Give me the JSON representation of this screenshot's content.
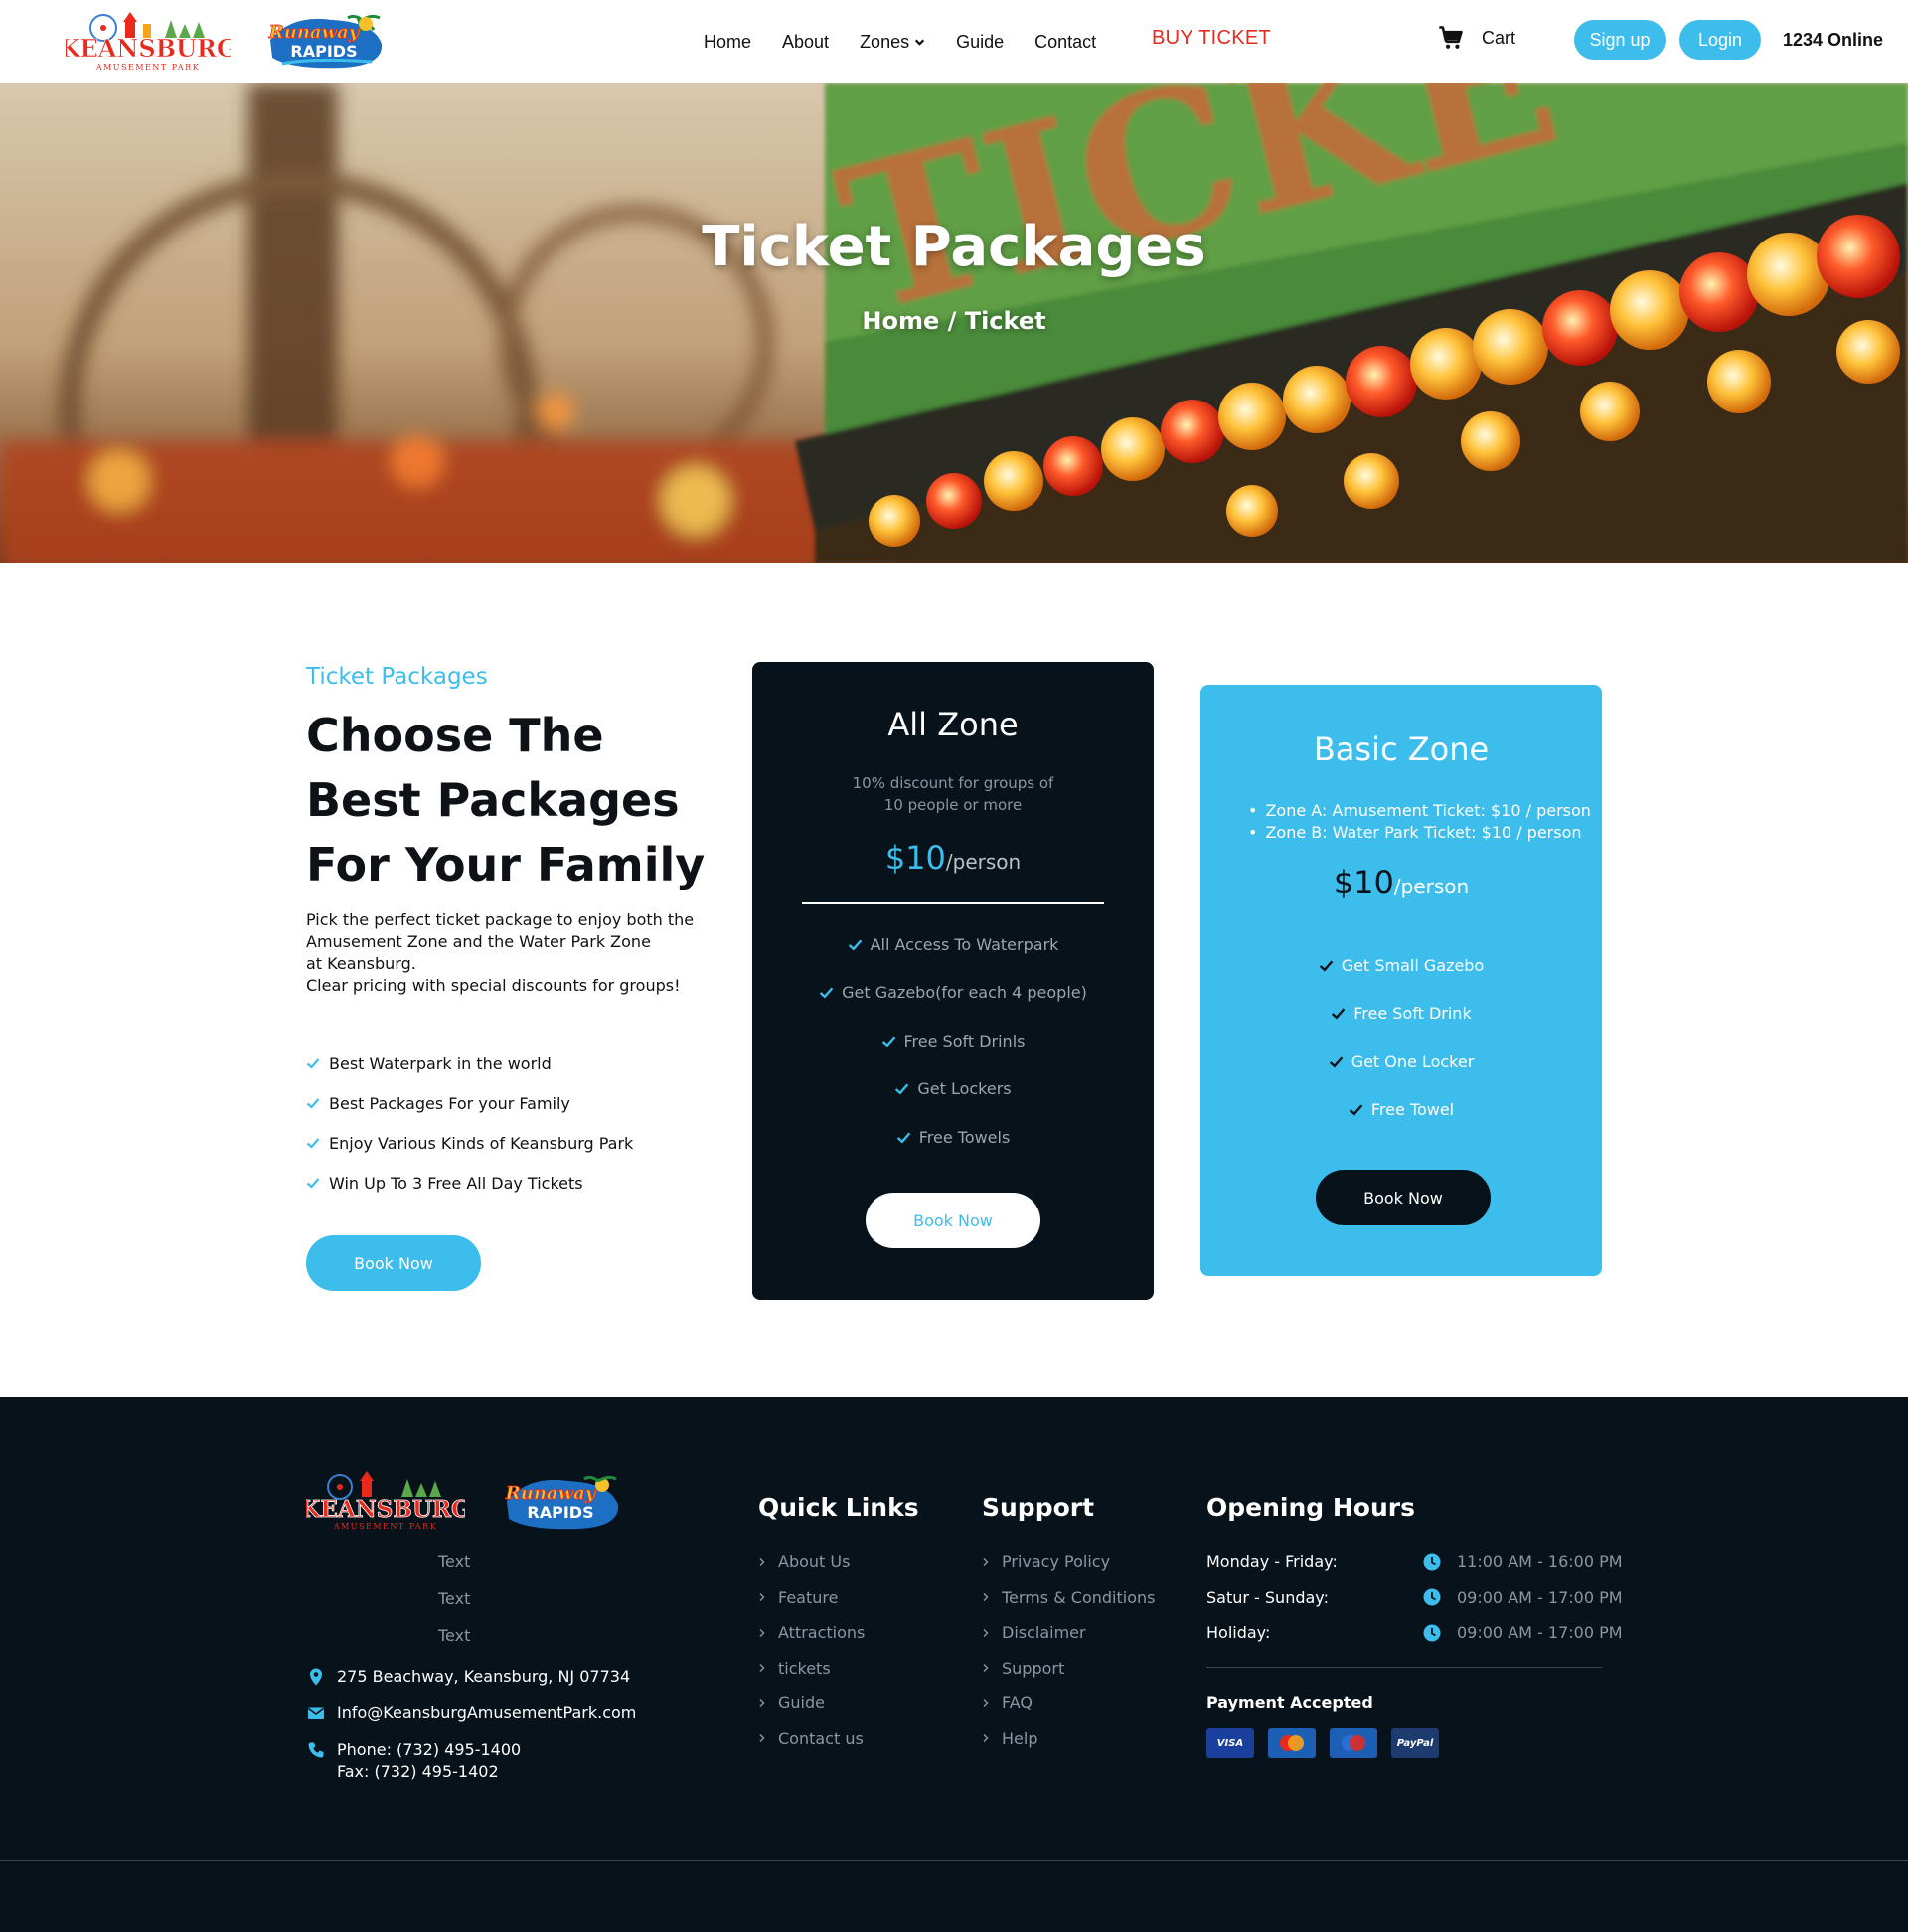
{
  "header": {
    "logo_keansburg": {
      "icon": "keansburg-logo",
      "text": "KEANSBURG",
      "subtext": "AMUSEMENT PARK"
    },
    "logo_runaway": {
      "icon": "runaway-rapids-logo",
      "text": "Runaway",
      "subtext": "RAPIDS"
    },
    "nav": {
      "home": "Home",
      "about": "About",
      "zones": "Zones",
      "guide": "Guide",
      "contact": "Contact"
    },
    "buy_ticket": "BUY TICKET",
    "cart": "Cart",
    "signup": "Sign up",
    "login": "Login",
    "online": "1234 Online"
  },
  "hero": {
    "title": "Ticket Packages",
    "breadcrumb": "Home / Ticket"
  },
  "intro": {
    "kicker": "Ticket Packages",
    "heading_line1": "Choose The",
    "heading_line2": "Best Packages",
    "heading_line3": "For Your Family",
    "paragraph": "Pick the perfect ticket package to enjoy both the\nAmusement Zone and the Water Park Zone\nat Keansburg.\nClear pricing with special discounts for groups!",
    "features": [
      "Best Waterpark in the world",
      "Best Packages For your Family",
      "Enjoy Various Kinds of Keansburg Park",
      "Win Up To 3 Free All Day Tickets"
    ],
    "button": "Book Now"
  },
  "all_zone": {
    "title": "All Zone",
    "subtitle": "10% discount for groups of\n10 people or more",
    "price": "$10",
    "per": "/person",
    "features": [
      "All Access To Waterpark",
      "Get Gazebo(for each 4 people)",
      "Free Soft Drinls",
      "Get Lockers",
      "Free Towels"
    ],
    "button": "Book Now"
  },
  "basic_zone": {
    "title": "Basic Zone",
    "zones": [
      "Zone A: Amusement Ticket: $10 / person",
      "Zone B: Water Park Ticket: $10 / person"
    ],
    "price": "$10",
    "per": "/person",
    "features": [
      "Get Small Gazebo",
      "Free Soft Drink",
      "Get One Locker",
      "Free Towel"
    ],
    "button": "Book Now"
  },
  "footer": {
    "texts": [
      "Text",
      "Text",
      "Text"
    ],
    "address": "275 Beachway, Keansburg, NJ 07734",
    "email": "Info@KeansburgAmusementPark.com",
    "phone": "Phone: (732) 495-1400\nFax: (732) 495-1402",
    "quick_links": {
      "title": "Quick Links",
      "items": [
        "About Us",
        "Feature",
        "Attractions",
        "tickets",
        "Guide",
        "Contact us"
      ]
    },
    "support": {
      "title": "Support",
      "items": [
        "Privacy Policy",
        "Terms & Conditions",
        "Disclaimer",
        "Support",
        "FAQ",
        "Help"
      ]
    },
    "hours": {
      "title": "Opening Hours",
      "rows": [
        {
          "day": "Monday - Friday:",
          "time": "11:00 AM - 16:00 PM"
        },
        {
          "day": "Satur - Sunday:",
          "time": "09:00 AM - 17:00 PM"
        },
        {
          "day": "Holiday:",
          "time": "09:00 AM - 17:00 PM"
        }
      ]
    },
    "payment_title": "Payment Accepted",
    "payment_methods": [
      "VISA",
      "MasterCard",
      "Maestro",
      "PayPal"
    ]
  },
  "colors": {
    "accent": "#3dbdec",
    "dark": "#07121a",
    "buy_ticket": "#e8291c"
  }
}
